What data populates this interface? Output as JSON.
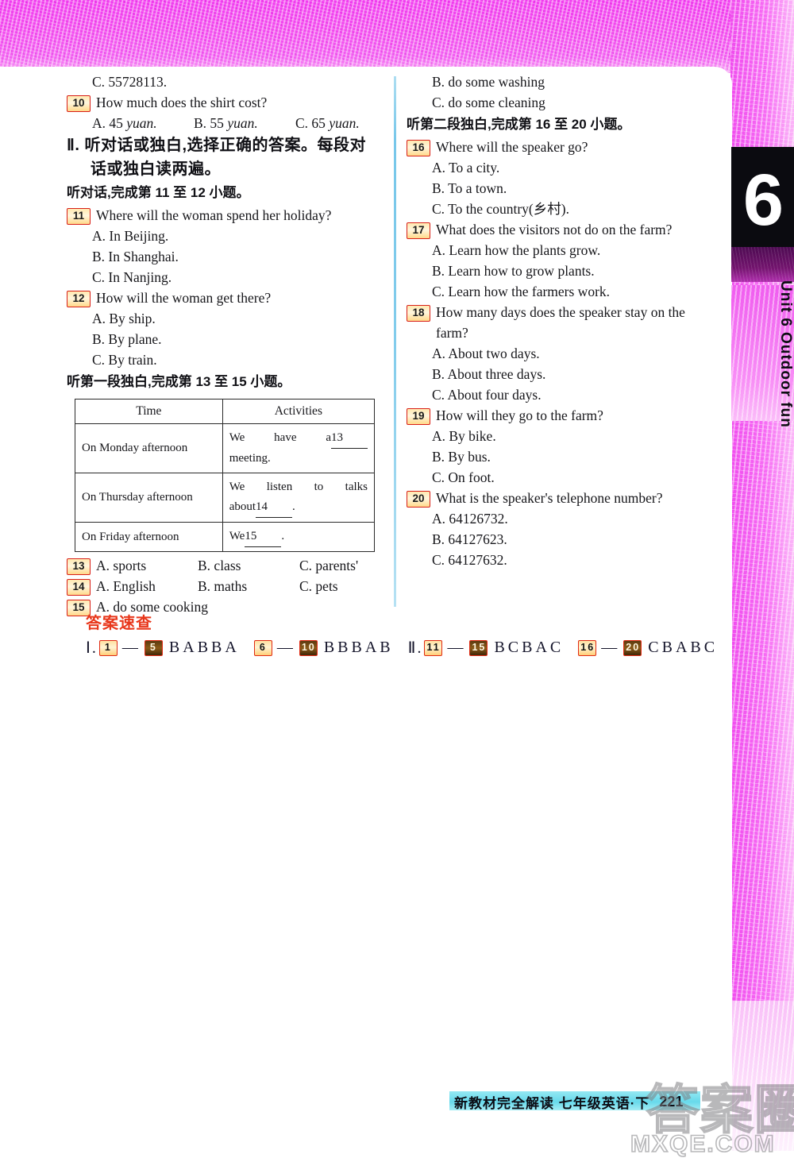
{
  "page": {
    "unit_tab": {
      "number": "6",
      "label": "Unit 6  Outdoor fun"
    },
    "footer": {
      "book_title": "新教材完全解读   七年级英语·下",
      "page_number": "221"
    },
    "watermark": {
      "chinese": "答案圈",
      "english": "MXQE.COM"
    }
  },
  "left_column": {
    "q9_option_c": "C. 55728113.",
    "q10": {
      "badge": "10",
      "stem": "How much does the shirt cost?",
      "options": [
        {
          "label": "A. 45 ",
          "italic": "yuan."
        },
        {
          "label": "B. 55 ",
          "italic": "yuan."
        },
        {
          "label": "C. 65 ",
          "italic": "yuan."
        }
      ]
    },
    "section2_heading_line1": "Ⅱ. 听对话或独白,选择正确的答案。每段对",
    "section2_heading_line2": "话或独白读两遍。",
    "dialogue_instruction": "听对话,完成第 11 至 12 小题。",
    "q11": {
      "badge": "11",
      "stem": "Where will the woman spend her holiday?",
      "options": [
        "A. In Beijing.",
        "B. In Shanghai.",
        "C. In Nanjing."
      ]
    },
    "q12": {
      "badge": "12",
      "stem": "How will the woman get there?",
      "options": [
        "A. By ship.",
        "B. By plane.",
        "C. By train."
      ]
    },
    "monologue1_instruction": "听第一段独白,完成第 13 至 15 小题。",
    "table": {
      "headers": [
        "Time",
        "Activities"
      ],
      "rows": [
        {
          "time": "On Monday afternoon",
          "activity_pre": "We    have    a",
          "blank": "13",
          "activity_post": "meeting."
        },
        {
          "time": "On Thursday afternoon",
          "activity_pre": "We    listen    to    talks",
          "activity_mid": "about",
          "blank": "14",
          "activity_post": "."
        },
        {
          "time": "On Friday afternoon",
          "activity_pre": "We",
          "blank": "15",
          "activity_post": "."
        }
      ]
    },
    "q13": {
      "badge": "13",
      "options": [
        "A. sports",
        "B. class",
        "C. parents'"
      ]
    },
    "q14": {
      "badge": "14",
      "options": [
        "A. English",
        "B. maths",
        "C. pets"
      ]
    },
    "q15": {
      "badge": "15",
      "options": [
        "A. do some cooking"
      ]
    }
  },
  "right_column": {
    "q15_option_b": "B. do some washing",
    "q15_option_c": "C. do some cleaning",
    "monologue2_instruction": "听第二段独白,完成第 16 至 20 小题。",
    "q16": {
      "badge": "16",
      "stem": "Where will the speaker go?",
      "options": [
        "A. To a city.",
        "B. To a town.",
        "C. To the country(乡村)."
      ]
    },
    "q17": {
      "badge": "17",
      "stem": "What does the visitors not do on the farm?",
      "options": [
        "A. Learn how the plants grow.",
        "B. Learn how to grow plants.",
        "C. Learn how the farmers work."
      ]
    },
    "q18": {
      "badge": "18",
      "stem_line1": "How  many  days  does  the  speaker  stay  on  the",
      "stem_line2": "farm?",
      "options": [
        "A. About two days.",
        "B. About three days.",
        "C. About four days."
      ]
    },
    "q19": {
      "badge": "19",
      "stem": "How will they go to the farm?",
      "options": [
        "A. By bike.",
        "B. By bus.",
        "C. On foot."
      ]
    },
    "q20": {
      "badge": "20",
      "stem": "What is the speaker's telephone number?",
      "options": [
        "A. 64126732.",
        "B. 64127623.",
        "C. 64127632."
      ]
    }
  },
  "answer_key": {
    "title": "答案速查",
    "groups": [
      {
        "roman": "Ⅰ.",
        "from": "1",
        "to": "5",
        "dash": "—",
        "answers": "BABBA"
      },
      {
        "roman": "",
        "from": "6",
        "to": "10",
        "dash": "—",
        "answers": "BBBAB"
      },
      {
        "roman": "Ⅱ.",
        "from": "11",
        "to": "15",
        "dash": "—",
        "answers": "BCBAC"
      },
      {
        "roman": "",
        "from": "16",
        "to": "20",
        "dash": "—",
        "answers": "CBABC"
      }
    ]
  },
  "colors": {
    "badge_border": "#d81f17",
    "answer_title": "#e8371b",
    "divider": "#6cc3e8",
    "scan_background": "#f23bf0",
    "footer_band": "#5fd7ea"
  }
}
